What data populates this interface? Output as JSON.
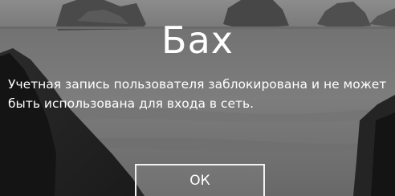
{
  "lock_screen": {
    "user_name": "Бах",
    "message": "Учетная запись пользователя заблокирована и не может быть использована для входа в сеть.",
    "ok_label": "ОК"
  }
}
